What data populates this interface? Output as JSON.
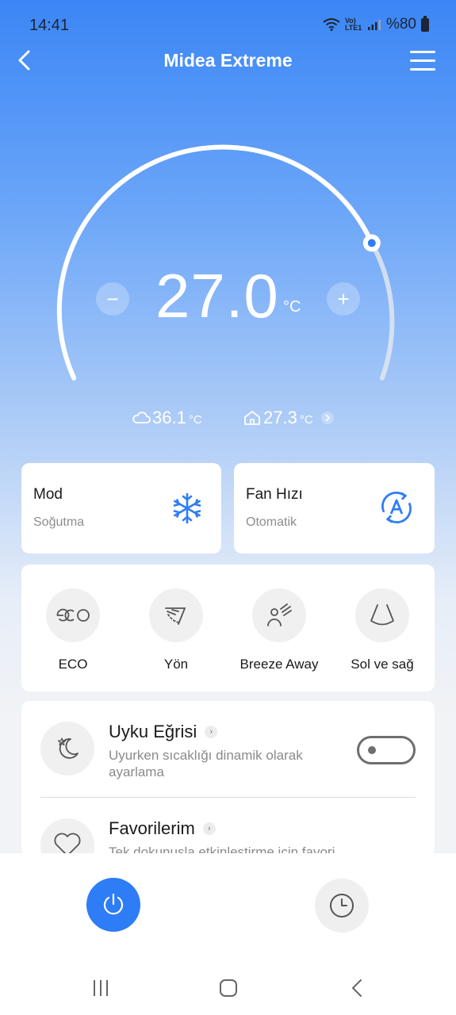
{
  "status_bar": {
    "time": "14:41",
    "network_badge": "Vo) LTE1",
    "battery_text": "%80"
  },
  "header": {
    "title": "Midea Extreme",
    "back_icon": "chevron-left-icon",
    "menu_icon": "hamburger-menu-icon"
  },
  "temperature": {
    "setpoint": "27.0",
    "unit": "°C",
    "minus_label": "−",
    "plus_label": "+"
  },
  "readings": {
    "outdoor": {
      "icon": "cloud-icon",
      "value": "36.1",
      "unit": "°C"
    },
    "indoor": {
      "icon": "house-icon",
      "value": "27.3",
      "unit": "°C"
    }
  },
  "mode_card": {
    "label": "Mod",
    "value": "Soğutma",
    "icon": "snowflake-icon"
  },
  "fan_card": {
    "label": "Fan Hızı",
    "value": "Otomatik",
    "icon": "fan-auto-icon"
  },
  "features": [
    {
      "label": "ECO",
      "icon": "eco-icon"
    },
    {
      "label": "Yön",
      "icon": "direction-icon"
    },
    {
      "label": "Breeze Away",
      "icon": "breeze-away-icon"
    },
    {
      "label": "Sol ve sağ",
      "icon": "swing-left-right-icon"
    }
  ],
  "settings": {
    "sleep_curve": {
      "title": "Uyku Eğrisi",
      "description": "Uyurken sıcaklığı dinamik olarak ayarlama",
      "toggle_on": false
    },
    "favorites": {
      "title": "Favorilerim",
      "description": "Tek dokunuşla etkinleştirme için favori"
    }
  },
  "bottom_controls": {
    "power_icon": "power-icon",
    "timer_icon": "clock-icon"
  },
  "colors": {
    "accent": "#2e7cf6",
    "header_gradient_top": "#3b86f6",
    "background": "#f1f3f6"
  }
}
